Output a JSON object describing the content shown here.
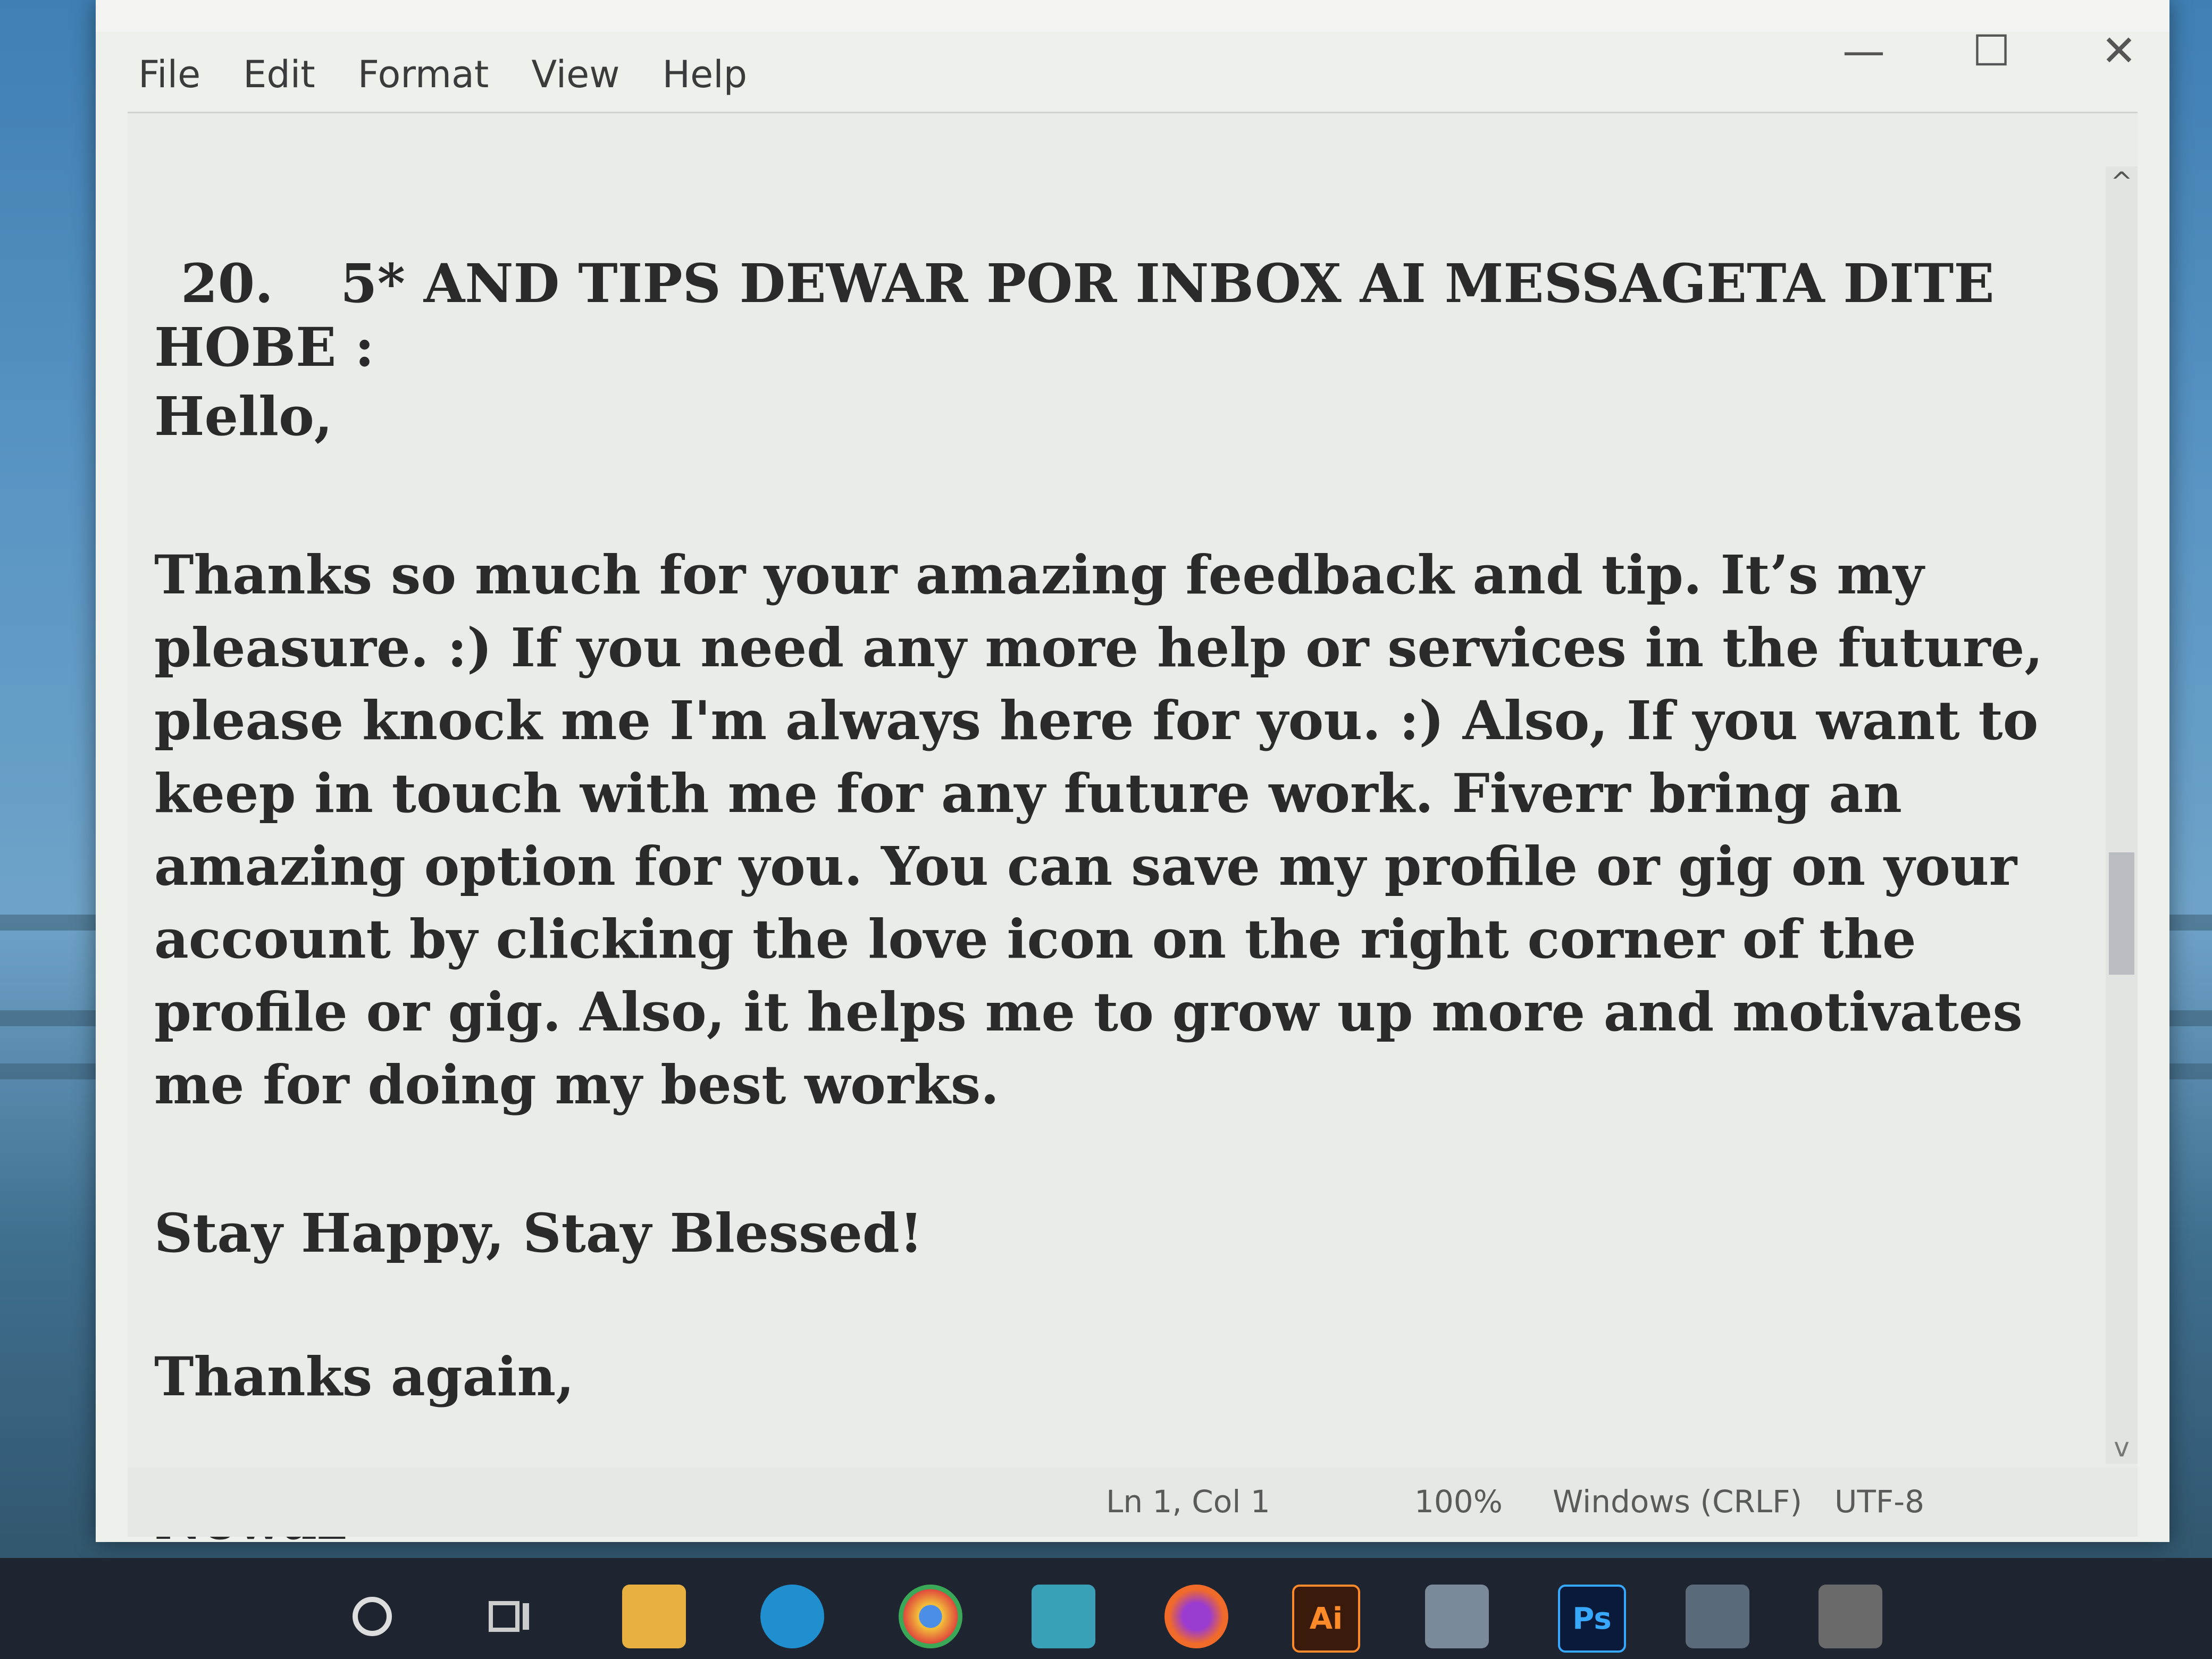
{
  "menu": {
    "file": "File",
    "edit": "Edit",
    "format": "Format",
    "view": "View",
    "help": "Help"
  },
  "window_controls": {
    "minimize": "—",
    "maximize": "☐",
    "close": "✕"
  },
  "document": {
    "heading_number": "20.",
    "heading_text": "5* AND TIPS DEWAR POR INBOX  AI MESSAGETA DITE HOBE :",
    "greeting": "Hello,",
    "body": "Thanks so much for your amazing feedback and tip. It’s my pleasure. :) If you need any more help or services in the future, please knock me I'm always here for you. :) Also, If you want to keep in touch with me for any future work. Fiverr bring an amazing option for you. You can save my profile or gig on your account by clicking the love icon on the right corner of the profile or gig. Also, it helps me to grow up more and motivates me for doing my best works.",
    "closing_line": "Stay Happy, Stay Blessed!",
    "thanks": "Thanks again,",
    "signature": "Newaz"
  },
  "statusbar": {
    "position": "Ln 1, Col 1",
    "zoom": "100%",
    "line_endings": "Windows (CRLF)",
    "encoding": "UTF-8"
  },
  "taskbar": {
    "icons": [
      "search-icon",
      "task-view-icon",
      "file-explorer-icon",
      "edge-icon",
      "chrome-icon",
      "mail-icon",
      "firefox-icon",
      "illustrator-icon",
      "store-icon",
      "photoshop-icon",
      "app-icon",
      "app-icon"
    ],
    "illustrator_label": "Ai",
    "photoshop_label": "Ps"
  }
}
